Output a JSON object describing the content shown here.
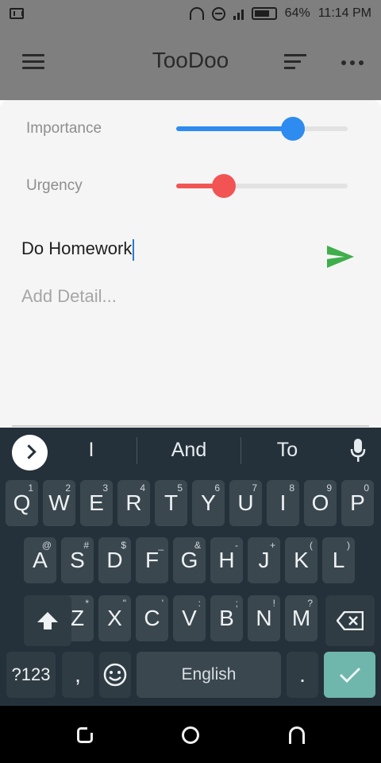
{
  "status_bar": {
    "battery": "64%",
    "time": "11:14 PM"
  },
  "app_bar": {
    "title": "TooDoo"
  },
  "sheet": {
    "importance": {
      "label": "Importance",
      "value": 0.68,
      "color": "#2e8bf0"
    },
    "urgency": {
      "label": "Urgency",
      "value": 0.28,
      "color": "#f15453"
    },
    "task_input": {
      "value": "Do Homework"
    },
    "detail_input": {
      "placeholder": "Add Detail..."
    },
    "send_color": "#3fae4c"
  },
  "keyboard": {
    "suggestions": [
      "I",
      "And",
      "To"
    ],
    "row1": [
      {
        "key": "Q",
        "hint": "1"
      },
      {
        "key": "W",
        "hint": "2"
      },
      {
        "key": "E",
        "hint": "3"
      },
      {
        "key": "R",
        "hint": "4"
      },
      {
        "key": "T",
        "hint": "5"
      },
      {
        "key": "Y",
        "hint": "6"
      },
      {
        "key": "U",
        "hint": "7"
      },
      {
        "key": "I",
        "hint": "8"
      },
      {
        "key": "O",
        "hint": "9"
      },
      {
        "key": "P",
        "hint": "0"
      }
    ],
    "row2": [
      {
        "key": "A",
        "hint": "@"
      },
      {
        "key": "S",
        "hint": "#"
      },
      {
        "key": "D",
        "hint": "$"
      },
      {
        "key": "F",
        "hint": "_"
      },
      {
        "key": "G",
        "hint": "&"
      },
      {
        "key": "H",
        "hint": "-"
      },
      {
        "key": "J",
        "hint": "+"
      },
      {
        "key": "K",
        "hint": "("
      },
      {
        "key": "L",
        "hint": ")"
      }
    ],
    "row3": [
      {
        "key": "Z",
        "hint": "*"
      },
      {
        "key": "X",
        "hint": "\""
      },
      {
        "key": "C",
        "hint": "'"
      },
      {
        "key": "V",
        "hint": ":"
      },
      {
        "key": "B",
        "hint": ";"
      },
      {
        "key": "N",
        "hint": "!"
      },
      {
        "key": "M",
        "hint": "?"
      }
    ],
    "symbols_label": "?123",
    "comma_label": ",",
    "space_label": "English",
    "period_label": "."
  }
}
